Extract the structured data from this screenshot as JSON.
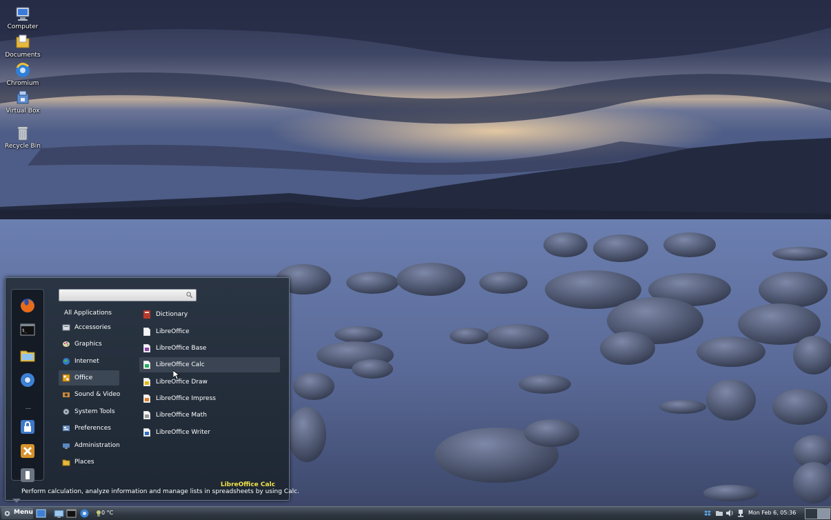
{
  "desktop": {
    "icons": [
      {
        "label": "Computer",
        "icon": "computer-icon"
      },
      {
        "label": "Documents",
        "icon": "folder-icon"
      },
      {
        "label": "Chromium",
        "icon": "chromium-icon"
      },
      {
        "label": "Virtual Box",
        "icon": "virtualbox-icon"
      },
      {
        "label": "Recycle Bin",
        "icon": "trash-icon"
      }
    ]
  },
  "menu": {
    "search": {
      "value": "",
      "placeholder": ""
    },
    "favorites": [
      "firefox-icon",
      "terminal-icon",
      "file-manager-icon",
      "chromium-icon",
      "lock-screen-icon",
      "logout-icon",
      "shutdown-icon"
    ],
    "categories": [
      {
        "label": "All Applications",
        "icon": ""
      },
      {
        "label": "Accessories",
        "icon": "accessories-icon"
      },
      {
        "label": "Graphics",
        "icon": "graphics-icon"
      },
      {
        "label": "Internet",
        "icon": "internet-icon"
      },
      {
        "label": "Office",
        "icon": "office-icon"
      },
      {
        "label": "Sound & Video",
        "icon": "multimedia-icon"
      },
      {
        "label": "System Tools",
        "icon": "system-tools-icon"
      },
      {
        "label": "Preferences",
        "icon": "preferences-icon"
      },
      {
        "label": "Administration",
        "icon": "administration-icon"
      },
      {
        "label": "Places",
        "icon": "places-icon"
      }
    ],
    "selected_category": "Office",
    "apps": [
      {
        "label": "Dictionary",
        "icon": "dictionary-icon",
        "color": "#c0392b"
      },
      {
        "label": "LibreOffice",
        "icon": "libreoffice-icon",
        "color": "#dddddd"
      },
      {
        "label": "LibreOffice Base",
        "icon": "libreoffice-base-icon",
        "color": "#8e44ad"
      },
      {
        "label": "LibreOffice Calc",
        "icon": "libreoffice-calc-icon",
        "color": "#27ae60"
      },
      {
        "label": "LibreOffice Draw",
        "icon": "libreoffice-draw-icon",
        "color": "#e6b800"
      },
      {
        "label": "LibreOffice Impress",
        "icon": "libreoffice-impress-icon",
        "color": "#e67e22"
      },
      {
        "label": "LibreOffice Math",
        "icon": "libreoffice-math-icon",
        "color": "#999999"
      },
      {
        "label": "LibreOffice Writer",
        "icon": "libreoffice-writer-icon",
        "color": "#2e6fc0"
      }
    ],
    "hovered_app": "LibreOffice Calc",
    "description": {
      "title": "LibreOffice Calc",
      "text": "Perform calculation, analyze information and manage lists in spreadsheets by using Calc."
    }
  },
  "taskbar": {
    "menu_label": "Menu",
    "launchers": [
      "show-desktop-icon",
      "file-manager-icon",
      "terminal-icon",
      "chromium-icon"
    ],
    "temperature": "0 °C",
    "tray": [
      "dropbox-icon",
      "folder-icon",
      "volume-icon",
      "network-icon"
    ],
    "clock": "Mon Feb  6, 05:36",
    "workspaces": 2,
    "active_workspace": 2
  },
  "colors": {
    "panel_bg": "#232d3a",
    "description_title": "#f1e24a",
    "taskbar_bg": "#2e3640"
  }
}
